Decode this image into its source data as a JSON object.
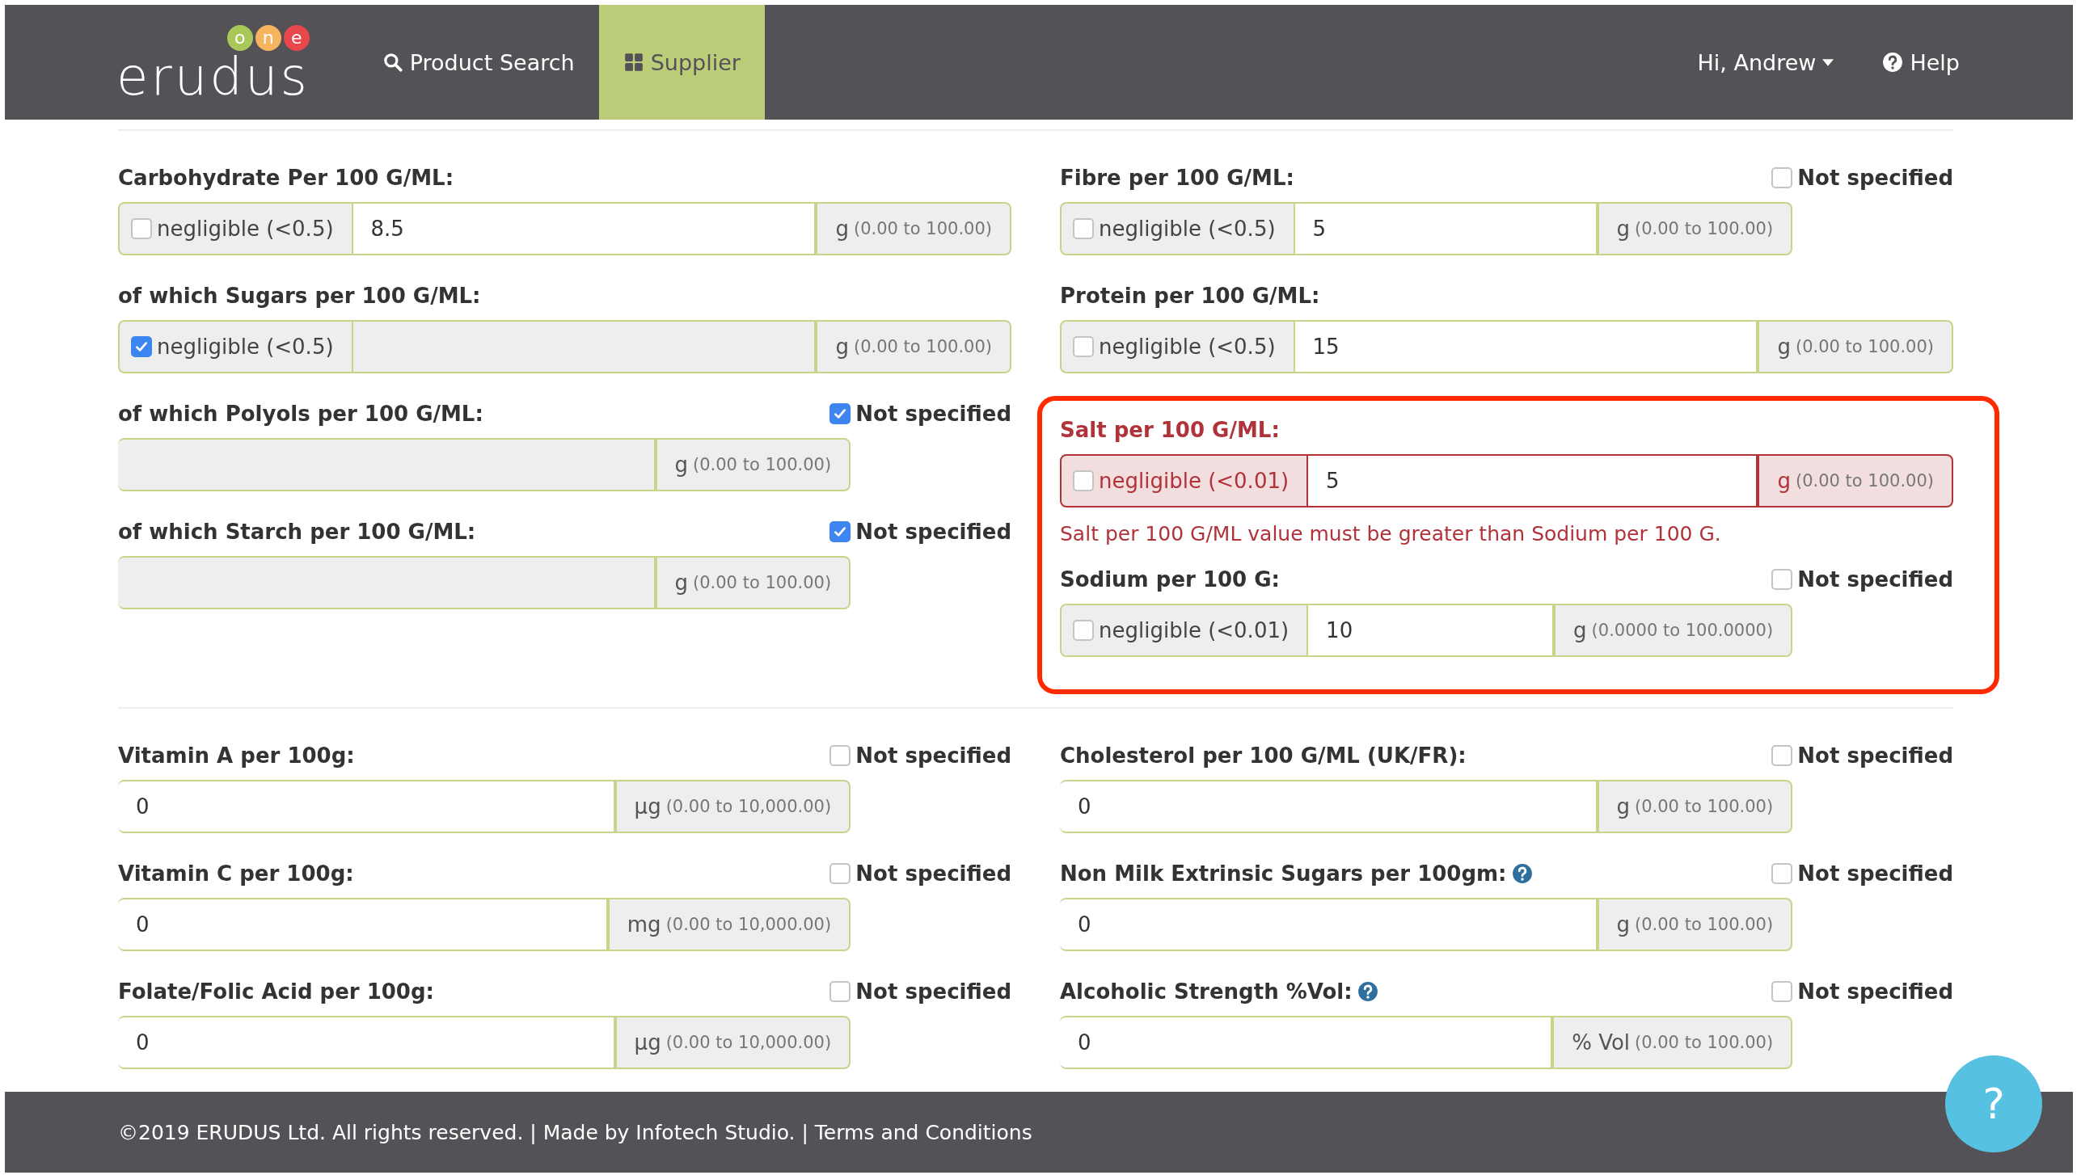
{
  "header": {
    "logo": {
      "text": "erudus",
      "badges": [
        {
          "letter": "o",
          "color": "#a8c95a"
        },
        {
          "letter": "n",
          "color": "#f7b45e"
        },
        {
          "letter": "e",
          "color": "#e8474c"
        }
      ]
    },
    "nav": [
      {
        "label": "Product Search",
        "selected": false
      },
      {
        "label": "Supplier",
        "selected": true
      }
    ],
    "user": "Hi, Andrew",
    "help": "Help"
  },
  "sections": [
    {
      "columns": [
        {
          "groups": [
            {
              "highlighted": false,
              "fields": [
                {
                  "label": "Carbohydrate Per 100 G/ML:",
                  "negligible": {
                    "label": "negligible (<0.5)",
                    "checked": false
                  },
                  "value": "8.5",
                  "unit": "g",
                  "range": "(0.00 to 100.00)",
                  "error": false
                },
                {
                  "label": "of which Sugars per 100 G/ML:",
                  "negligible": {
                    "label": "negligible (<0.5)",
                    "checked": true
                  },
                  "unit": "g",
                  "range": "(0.00 to 100.00)",
                  "error": false
                },
                {
                  "label": "of which Polyols per 100 G/ML:",
                  "not_specified": {
                    "label": "Not specified",
                    "checked": true
                  },
                  "unit": "g",
                  "range": "(0.00 to 100.00)",
                  "error": false
                },
                {
                  "label": "of which Starch per 100 G/ML:",
                  "not_specified": {
                    "label": "Not specified",
                    "checked": true
                  },
                  "unit": "g",
                  "range": "(0.00 to 100.00)",
                  "error": false
                }
              ]
            }
          ]
        },
        {
          "groups": [
            {
              "highlighted": false,
              "fields": [
                {
                  "label": "Fibre per 100 G/ML:",
                  "not_specified": {
                    "label": "Not specified",
                    "checked": false
                  },
                  "negligible": {
                    "label": "negligible (<0.5)",
                    "checked": false
                  },
                  "value": "5",
                  "unit": "g",
                  "range": "(0.00 to 100.00)",
                  "error": false
                },
                {
                  "label": "Protein per 100 G/ML:",
                  "negligible": {
                    "label": "negligible (<0.5)",
                    "checked": false
                  },
                  "value": "15",
                  "unit": "g",
                  "range": "(0.00 to 100.00)",
                  "error": false
                }
              ]
            },
            {
              "highlighted": true,
              "fields": [
                {
                  "label": "Salt per 100 G/ML:",
                  "negligible": {
                    "label": "negligible (<0.01)",
                    "checked": false
                  },
                  "value": "5",
                  "unit": "g",
                  "range": "(0.00 to 100.00)",
                  "error": true,
                  "error_message": "Salt per 100 G/ML value must be greater than Sodium per 100 G."
                },
                {
                  "label": "Sodium per 100 G:",
                  "not_specified": {
                    "label": "Not specified",
                    "checked": false
                  },
                  "negligible": {
                    "label": "negligible (<0.01)",
                    "checked": false
                  },
                  "value": "10",
                  "unit": "g",
                  "range": "(0.0000 to 100.0000)",
                  "error": false
                }
              ]
            }
          ]
        }
      ]
    },
    {
      "columns": [
        {
          "groups": [
            {
              "highlighted": false,
              "fields": [
                {
                  "label": "Vitamin A per 100g:",
                  "not_specified": {
                    "label": "Not specified",
                    "checked": false
                  },
                  "value": "0",
                  "unit": "µg",
                  "range": "(0.00 to 10,000.00)",
                  "error": false
                },
                {
                  "label": "Vitamin C per 100g:",
                  "not_specified": {
                    "label": "Not specified",
                    "checked": false
                  },
                  "value": "0",
                  "unit": "mg",
                  "range": "(0.00 to 10,000.00)",
                  "error": false
                },
                {
                  "label": "Folate/Folic Acid per 100g:",
                  "not_specified": {
                    "label": "Not specified",
                    "checked": false
                  },
                  "value": "0",
                  "unit": "µg",
                  "range": "(0.00 to 10,000.00)",
                  "error": false
                }
              ]
            }
          ]
        },
        {
          "groups": [
            {
              "highlighted": false,
              "fields": [
                {
                  "label": "Cholesterol per 100 G/ML (UK/FR):",
                  "not_specified": {
                    "label": "Not specified",
                    "checked": false
                  },
                  "value": "0",
                  "unit": "g",
                  "range": "(0.00 to 100.00)",
                  "error": false
                },
                {
                  "label": "Non Milk Extrinsic Sugars per 100gm:",
                  "help": true,
                  "not_specified": {
                    "label": "Not specified",
                    "checked": false
                  },
                  "value": "0",
                  "unit": "g",
                  "range": "(0.00 to 100.00)",
                  "error": false
                },
                {
                  "label": "Alcoholic Strength %Vol:",
                  "help": true,
                  "not_specified": {
                    "label": "Not specified",
                    "checked": false
                  },
                  "value": "0",
                  "unit": "% Vol",
                  "range": "(0.00 to 100.00)",
                  "error": false
                }
              ]
            }
          ]
        }
      ]
    }
  ],
  "footer": {
    "text": "©2019 ERUDUS Ltd. All rights reserved. | Made by Infotech Studio. | Terms and Conditions"
  },
  "chat_button": "?"
}
